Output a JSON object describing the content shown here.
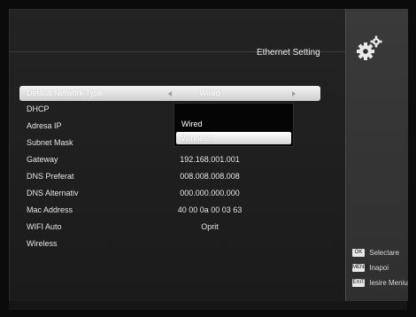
{
  "header": {
    "title": "Ethernet Setting",
    "icon": "settings-gears-icon"
  },
  "menu": {
    "rows": [
      {
        "label": "Default Network Type",
        "value": "Wired"
      },
      {
        "label": "DHCP",
        "value": ""
      },
      {
        "label": "Adresa IP",
        "value": ""
      },
      {
        "label": "Subnet Mask",
        "value": ""
      },
      {
        "label": "Gateway",
        "value": "192.168.001.001"
      },
      {
        "label": "DNS Preferat",
        "value": "008.008.008.008"
      },
      {
        "label": "DNS Alternativ",
        "value": "000.000.000.000"
      },
      {
        "label": "Mac Address",
        "value": "40 00 0a 00 03 63"
      },
      {
        "label": "WIFI Auto",
        "value": "Oprit"
      },
      {
        "label": "Wireless",
        "value": ""
      }
    ]
  },
  "dropdown": {
    "options": [
      "Wired",
      "Wireless"
    ],
    "highlighted": "Wireless"
  },
  "legend": {
    "items": [
      {
        "key": "OK",
        "label": "Selectare",
        "icon": "ok-key-icon"
      },
      {
        "key": "MENU",
        "label": "Inapoi",
        "icon": "menu-key-icon"
      },
      {
        "key": "EXIT",
        "label": "Iesire Meniu",
        "icon": "exit-key-icon"
      }
    ]
  }
}
